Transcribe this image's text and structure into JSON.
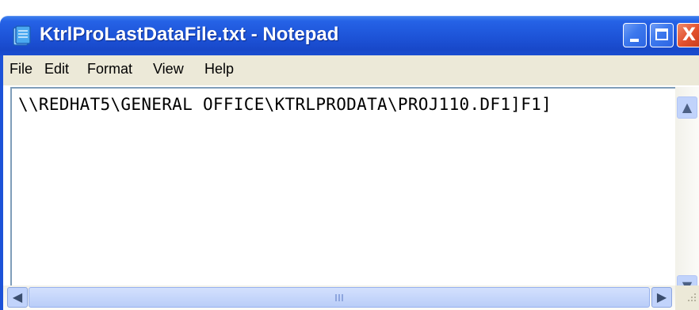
{
  "window": {
    "title": "KtrlProLastDataFile.txt - Notepad",
    "app_icon": "notepad-icon",
    "controls": {
      "minimize_icon": "minimize-icon",
      "maximize_icon": "maximize-icon",
      "close_icon": "close-icon",
      "close_glyph": "X"
    }
  },
  "menu": {
    "items": [
      {
        "label": "File"
      },
      {
        "label": "Edit"
      },
      {
        "label": "Format"
      },
      {
        "label": "View"
      },
      {
        "label": "Help"
      }
    ]
  },
  "editor": {
    "content": "\\\\REDHAT5\\GENERAL OFFICE\\KTRLPRODATA\\PROJ110.DF1]F1]"
  },
  "scrollbars": {
    "vertical": {
      "up_arrow": "▲",
      "down_arrow": "▼"
    },
    "horizontal": {
      "left_arrow": "◀",
      "right_arrow": "▶"
    }
  },
  "colors": {
    "titlebar": "#2562e6",
    "menubar": "#ece9d8",
    "close_button": "#e2512e"
  }
}
